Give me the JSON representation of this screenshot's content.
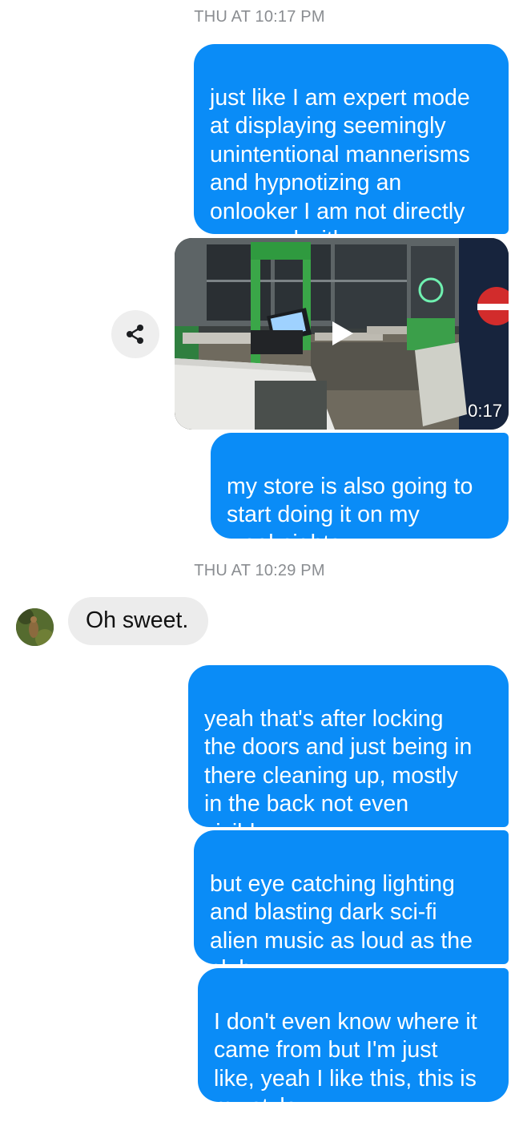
{
  "timestamps": [
    "THU AT 10:17 PM",
    "THU AT 10:29 PM"
  ],
  "messages": {
    "out1": "just like I am expert mode\nat displaying seemingly\nunintentional mannerisms\nand hypnotizing an\nonlooker I am not directly\nengaged with,",
    "video_duration": "0:17",
    "out2": "my store is also going to\nstart doing it on my\nweeknights",
    "in1": "Oh sweet.",
    "out3": "yeah that's after locking\nthe doors and just being in\nthere cleaning up, mostly\nin the back not even\nvisible",
    "out4": "but eye catching lighting\nand blasting dark sci-fi\nalien music as loud as the\nclub",
    "out5": "I don't even know where it\ncame from but I'm just\nlike, yeah I like this, this is\nmy style"
  },
  "icons": {
    "share": "share-icon",
    "play": "play-icon",
    "avatar": "contact-avatar"
  },
  "colors": {
    "outgoing_bubble": "#0a8cf7",
    "incoming_bubble": "#ececec",
    "timestamp": "#8a8d91"
  }
}
